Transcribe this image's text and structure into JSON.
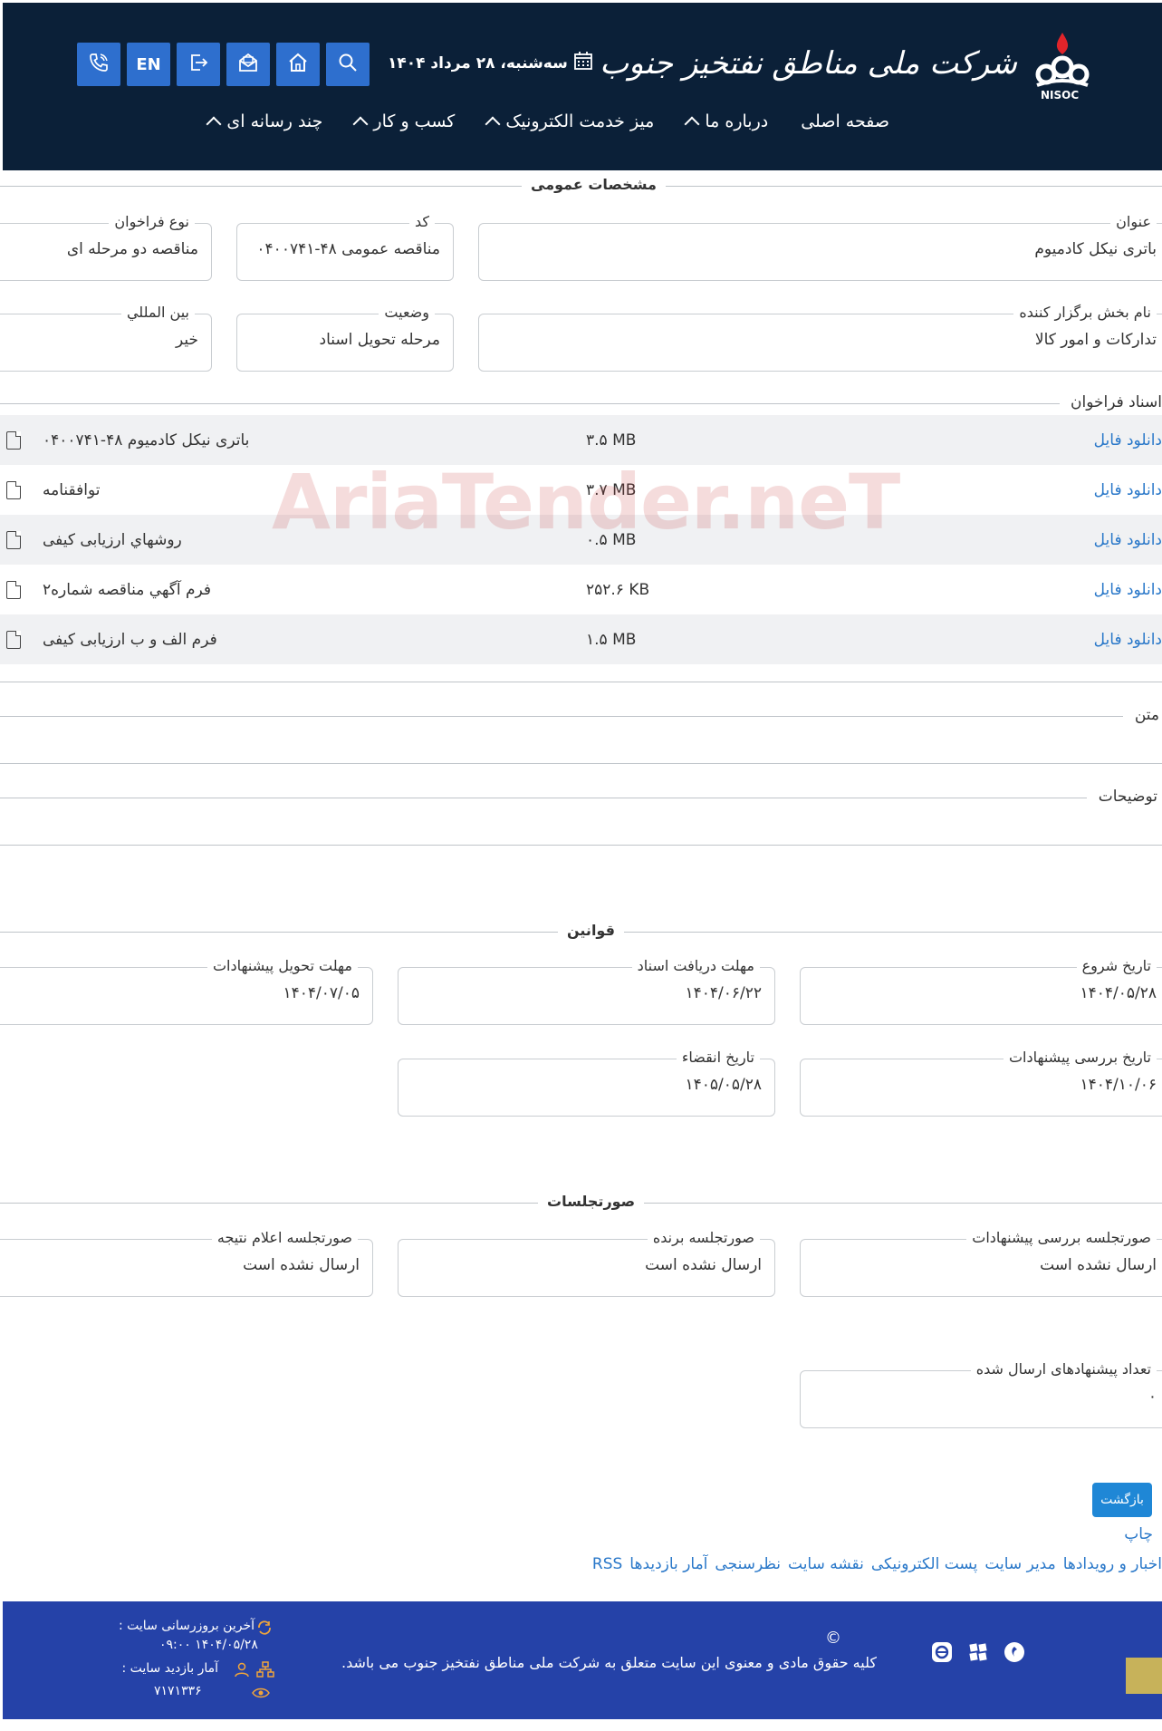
{
  "header": {
    "logo_text": "شرکت ملی مناطق نفتخیز جنوب",
    "logo_caption": "NISOC",
    "date": "سه‌شنبه، ۲۸ مرداد ۱۴۰۴",
    "lang_button": "EN",
    "nav": [
      {
        "label": "صفحه اصلی",
        "has_dropdown": false
      },
      {
        "label": "درباره ما",
        "has_dropdown": true
      },
      {
        "label": "میز خدمت الکترونیک",
        "has_dropdown": true
      },
      {
        "label": "کسب و کار",
        "has_dropdown": true
      },
      {
        "label": "چند رسانه ای",
        "has_dropdown": true
      }
    ]
  },
  "general": {
    "section_title": "مشخصات عمومی",
    "title_label": "عنوان",
    "title_value": "باتری نیکل کادمیوم",
    "code_label": "کد",
    "code_value": "مناقصه عمومی ۴۸-۰۴۰۰۷۴۱",
    "call_type_label": "نوع فراخوان",
    "call_type_value": "مناقصه دو مرحله ای",
    "org_label": "نام بخش برگزار کننده",
    "org_value": "تدارکات و امور کالا",
    "status_label": "وضعیت",
    "status_value": "مرحله تحویل اسناد",
    "intl_label": "بین المللي",
    "intl_value": "خیر"
  },
  "documents": {
    "label": "اسناد فراخوان",
    "download_label": "دانلود فایل",
    "items": [
      {
        "name": "باتری نیکل کادمیوم ۴۸-۰۴۰۰۷۴۱",
        "size": "۳.۵ MB"
      },
      {
        "name": "توافقنامه",
        "size": "۳.۷ MB"
      },
      {
        "name": "روشهاي ارزيابی كيفی",
        "size": "۰.۵ MB"
      },
      {
        "name": "فرم آگهي مناقصه شماره۲",
        "size": "۲۵۲.۶ KB"
      },
      {
        "name": "فرم الف و ب ارزيابی كيفی",
        "size": "۱.۵ MB"
      }
    ]
  },
  "text_label": "متن",
  "notes_label": "توضیحات",
  "rules": {
    "section_title": "قوانین",
    "start_label": "تاریخ شروع",
    "start_value": "۱۴۰۴/۰۵/۲۸",
    "doc_deadline_label": "مهلت دریافت اسناد",
    "doc_deadline_value": "۱۴۰۴/۰۶/۲۲",
    "offer_deadline_label": "مهلت تحویل پیشنهادات",
    "offer_deadline_value": "۱۴۰۴/۰۷/۰۵",
    "review_label": "تاریخ بررسی پیشنهادات",
    "review_value": "۱۴۰۴/۱۰/۰۶",
    "expiry_label": "تاریخ انقضاء",
    "expiry_value": "۱۴۰۵/۰۵/۲۸"
  },
  "minutes": {
    "section_title": "صورتجلسات",
    "review_label": "صورتجلسه بررسی پیشنهادات",
    "review_value": "ارسال نشده است",
    "winner_label": "صورتجلسه برنده",
    "winner_value": "ارسال نشده است",
    "result_label": "صورتجلسه اعلام نتیجه",
    "result_value": "ارسال نشده است"
  },
  "offers": {
    "count_label": "تعداد پیشنهادهای ارسال شده",
    "count_value": "۰"
  },
  "actions": {
    "back_label": "بازگشت",
    "print_label": "چاپ"
  },
  "footer_links": [
    "اخبار و رویدادها",
    "مدیر سایت",
    "پست الکترونیکی",
    "نقشه سایت",
    "نظرسنجی",
    "آمار بازدیدها",
    "RSS"
  ],
  "footer": {
    "copyright_symbol": "©",
    "copyright_text": "کلیه حقوق مادی و معنوی این سایت متعلق به شرکت ملی مناطق نفتخیز جنوب می باشد.",
    "last_update_label": "آخرین بروزرسانی سایت :",
    "last_update_value": "۱۴۰۴/۰۵/۲۸ ۰۹:۰۰",
    "visits_label": "آمار بازدید سایت :",
    "visits_value": "۷۱۷۱۳۳۶"
  },
  "watermark": "AriaTender.neT",
  "colors": {
    "header_bg": "#0b2038",
    "button_blue": "#2e6fce",
    "link_blue": "#2a78c9",
    "footer_bg": "#2542a8"
  }
}
